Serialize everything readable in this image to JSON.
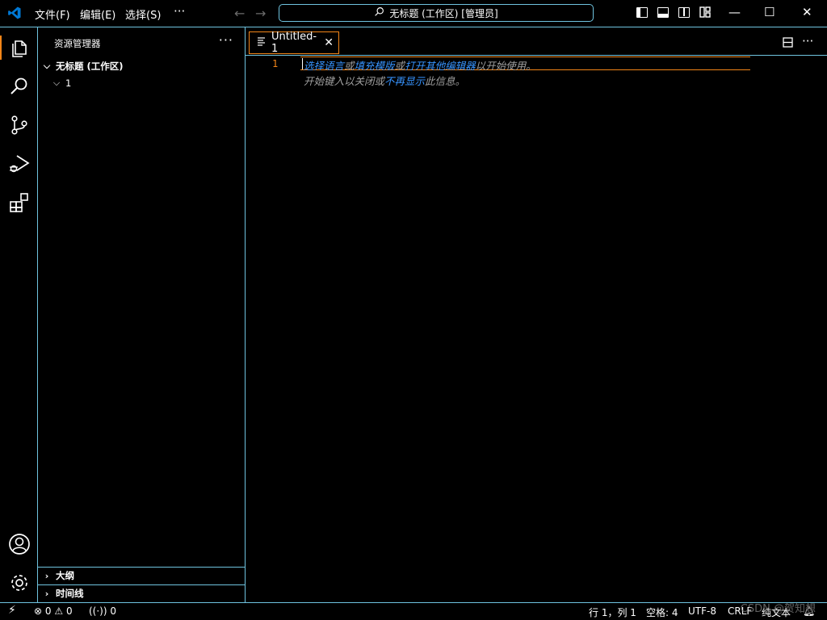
{
  "titlebar": {
    "menus": [
      "文件(F)",
      "编辑(E)",
      "选择(S)"
    ],
    "more": "···",
    "back_arrow": "←",
    "forward_arrow": "→",
    "command_center": "无标题 (工作区) [管理员]",
    "window_controls": {
      "minimize": "—",
      "maximize": "☐",
      "close": "✕"
    }
  },
  "activity_bar": {
    "icons": [
      "explorer-icon",
      "search-icon",
      "source-control-icon",
      "run-debug-icon",
      "extensions-icon",
      "accounts-icon",
      "manage-gear-icon"
    ]
  },
  "sidebar": {
    "title": "资源管理器",
    "more": "···",
    "workspace": "无标题 (工作区)",
    "folder": "1",
    "outline": "大纲",
    "timeline": "时间线"
  },
  "editor": {
    "tab": {
      "label": "Untitled-1",
      "close": "✕"
    },
    "line_number": "1",
    "hint_line1": {
      "link1": "选择语言",
      "t1": "或",
      "link2": "填充模版",
      "t2": "或",
      "link3": "打开其他编辑器",
      "t3": "以开始使用。"
    },
    "hint_line2": {
      "t1": "开始键入以关闭或",
      "link1": "不再显示",
      "t2": "此信息。"
    }
  },
  "statusbar": {
    "errors": "0",
    "warnings": "0",
    "ports": "0",
    "position": "行 1，列 1",
    "spaces": "空格: 4",
    "encoding": "UTF-8",
    "eol": "CRLF",
    "language": "纯文本",
    "watermark": "CSDN @贺知想"
  },
  "colors": {
    "border": "#6fc3df",
    "accent_orange": "#f38518",
    "link_blue": "#3794ff",
    "vscode_blue": "#0078d4"
  }
}
